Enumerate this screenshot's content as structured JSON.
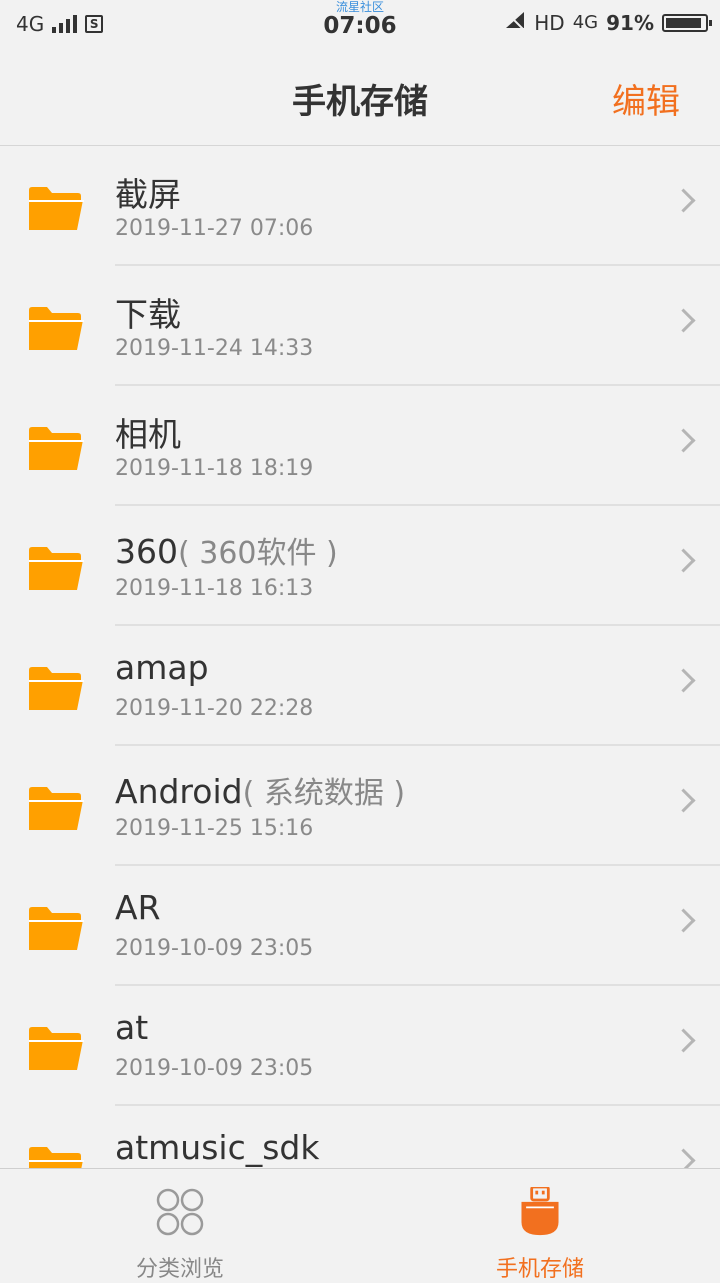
{
  "status_bar": {
    "network": "4G",
    "community": "流星社区",
    "time": "07:06",
    "hd": "HD",
    "network2": "4G",
    "battery": "91%",
    "battery_level": 0.91
  },
  "header": {
    "title": "手机存储",
    "edit": "编辑"
  },
  "colors": {
    "accent": "#f2701f",
    "folder": "#ffa000"
  },
  "files": [
    {
      "name": "截屏",
      "note": "",
      "date": "2019-11-27 07:06"
    },
    {
      "name": "下载",
      "note": "",
      "date": "2019-11-24 14:33"
    },
    {
      "name": "相机",
      "note": "",
      "date": "2019-11-18 18:19"
    },
    {
      "name": "360",
      "note": "( 360软件 )",
      "date": "2019-11-18 16:13"
    },
    {
      "name": "amap",
      "note": "",
      "date": "2019-11-20 22:28"
    },
    {
      "name": "Android",
      "note": "( 系统数据 )",
      "date": "2019-11-25 15:16"
    },
    {
      "name": "AR",
      "note": "",
      "date": "2019-10-09 23:05"
    },
    {
      "name": "at",
      "note": "",
      "date": "2019-10-09 23:05"
    },
    {
      "name": "atmusic_sdk",
      "note": "",
      "date": ""
    }
  ],
  "bottom_nav": {
    "tabs": [
      {
        "label": "分类浏览",
        "icon": "category-grid-icon",
        "active": false
      },
      {
        "label": "手机存储",
        "icon": "usb-storage-icon",
        "active": true
      }
    ]
  }
}
